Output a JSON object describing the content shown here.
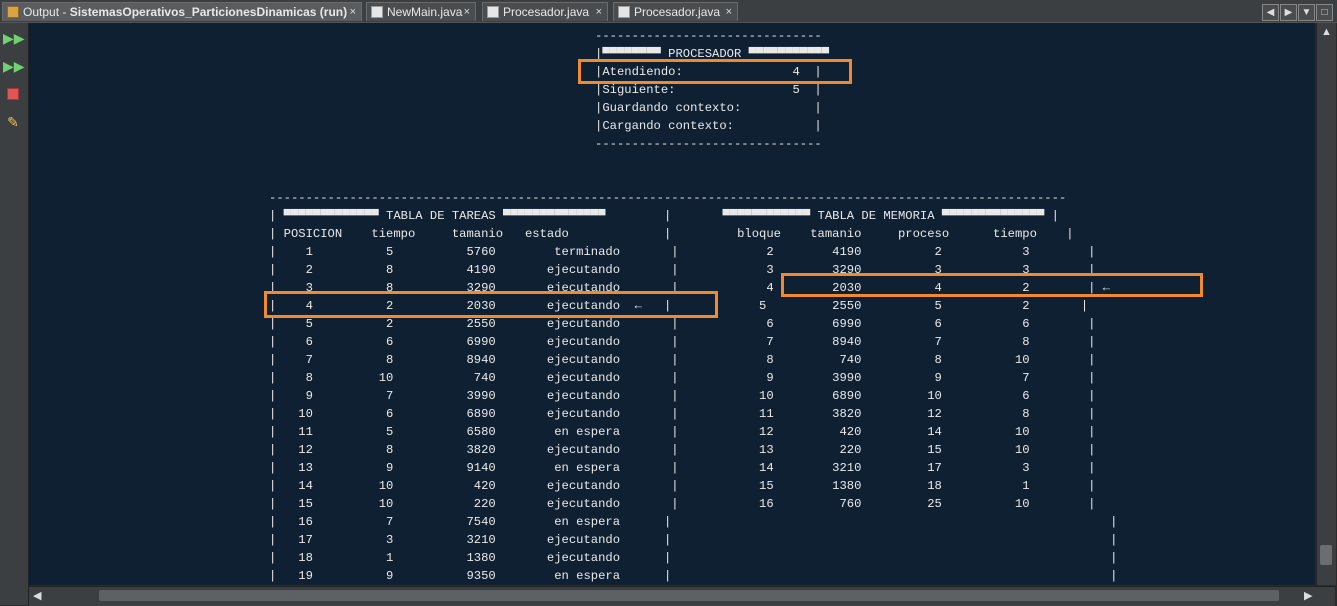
{
  "tabs": [
    {
      "label": "Output - ",
      "label_bold": "SistemasOperativos_ParticionesDinamicas (run)",
      "close": "×"
    },
    {
      "label": "NewMain.java",
      "close": "×"
    },
    {
      "label": "Procesador.java",
      "close": "×"
    },
    {
      "label": "Procesador.java",
      "close": "×"
    }
  ],
  "nav_buttons": [
    "◀",
    "▶",
    "▼",
    "□"
  ],
  "console": {
    "procesador": [
      "-------------------------------",
      "|▀▀▀▀▀▀▀▀ PROCESADOR ▀▀▀▀▀▀▀▀▀▀▀",
      "|Atendiendo:               4  |",
      "|Siguiente:                5  |",
      "|Guardando contexto:          |",
      "|Cargando contexto:           |",
      "-------------------------------"
    ],
    "tabla": [
      "-------------------------------------------------------------------------------------------------------------",
      "| ▀▀▀▀▀▀▀▀▀▀▀▀▀ TABLA DE TAREAS ▀▀▀▀▀▀▀▀▀▀▀▀▀▀        |       ▀▀▀▀▀▀▀▀▀▀▀▀ TABLA DE MEMORIA ▀▀▀▀▀▀▀▀▀▀▀▀▀▀ |",
      "| POSICION    tiempo     tamanio   estado             |         bloque    tamanio     proceso      tiempo    |",
      "|    1          5          5760        terminado       |            2        4190          2           3        |",
      "|    2          8          4190       ejecutando       |            3        3290          3           3        |",
      "|    3          8          3290       ejecutando       |            4        2030          4           2        | ←",
      "|    4          2          2030       ejecutando  ←   |            5         2550          5           2       |",
      "|    5          2          2550       ejecutando       |            6        6990          6           6        |",
      "|    6          6          6990       ejecutando       |            7        8940          7           8        |",
      "|    7          8          8940       ejecutando       |            8         740          8          10        |",
      "|    8         10           740       ejecutando       |            9        3990          9           7        |",
      "|    9          7          3990       ejecutando       |           10        6890         10           6        |",
      "|   10          6          6890       ejecutando       |           11        3820         12           8        |",
      "|   11          5          6580        en espera       |           12         420         14          10        |",
      "|   12          8          3820       ejecutando       |           13         220         15          10        |",
      "|   13          9          9140        en espera       |           14        3210         17           3        |",
      "|   14         10           420       ejecutando       |           15        1380         18           1        |",
      "|   15         10           220       ejecutando       |           16         760         25          10        |",
      "|   16          7          7540        en espera      |                                                            |",
      "|   17          3          3210       ejecutando      |                                                            |",
      "|   18          1          1380       ejecutando      |                                                            |",
      "|   19          9          9350        en espera      |                                                            |"
    ]
  },
  "highlight_color": "#f08a2c",
  "console_bg": "#0f2033"
}
